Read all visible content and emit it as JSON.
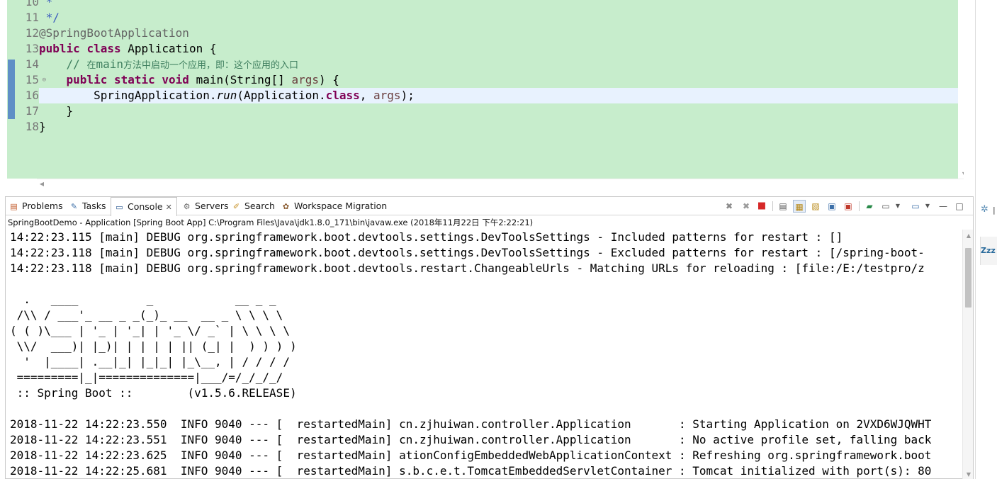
{
  "editor": {
    "line_numbers": [
      "10",
      "11",
      "12",
      "13",
      "14",
      "15",
      "16",
      "17",
      "18"
    ],
    "lines": [
      " *",
      " */",
      "@SpringBootApplication",
      "public class Application {",
      "    // 在main方法中启动一个应用，即：这个应用的入口",
      "    public static void main(String[] args) {",
      "        SpringApplication.run(Application.class, args);",
      "    }",
      "}"
    ],
    "fold_marker": "⊖",
    "background_color": "#c7edcc"
  },
  "panel": {
    "tabs": [
      {
        "label": "Problems",
        "icon": "problems-icon"
      },
      {
        "label": "Tasks",
        "icon": "tasks-icon"
      },
      {
        "label": "Console",
        "icon": "console-icon",
        "active": true,
        "close": "✕"
      },
      {
        "label": "Servers",
        "icon": "servers-icon"
      },
      {
        "label": "Search",
        "icon": "search-icon"
      },
      {
        "label": "Workspace Migration",
        "icon": "workspace-migration-icon"
      }
    ],
    "console_description": "SpringBootDemo - Application [Spring Boot App] C:\\Program Files\\Java\\jdk1.8.0_171\\bin\\javaw.exe (2018年11月22日 下午2:22:21)",
    "console_lines": [
      "14:22:23.115 [main] DEBUG org.springframework.boot.devtools.settings.DevToolsSettings - Included patterns for restart : []",
      "14:22:23.118 [main] DEBUG org.springframework.boot.devtools.settings.DevToolsSettings - Excluded patterns for restart : [/spring-boot-",
      "14:22:23.118 [main] DEBUG org.springframework.boot.devtools.restart.ChangeableUrls - Matching URLs for reloading : [file:/E:/testpro/z",
      "",
      "  .   ____          _            __ _ _",
      " /\\\\ / ___'_ __ _ _(_)_ __  __ _ \\ \\ \\ \\",
      "( ( )\\___ | '_ | '_| | '_ \\/ _` | \\ \\ \\ \\",
      " \\\\/  ___)| |_)| | | | | || (_| |  ) ) ) )",
      "  '  |____| .__|_| |_|_| |_\\__, | / / / /",
      " =========|_|==============|___/=/_/_/_/",
      " :: Spring Boot ::        (v1.5.6.RELEASE)",
      "",
      "2018-11-22 14:22:23.550  INFO 9040 --- [  restartedMain] cn.zjhuiwan.controller.Application       : Starting Application on 2VXD6WJQWHT",
      "2018-11-22 14:22:23.551  INFO 9040 --- [  restartedMain] cn.zjhuiwan.controller.Application       : No active profile set, falling back",
      "2018-11-22 14:22:23.625  INFO 9040 --- [  restartedMain] ationConfigEmbeddedWebApplicationContext : Refreshing org.springframework.boot",
      "2018-11-22 14:22:25.681  INFO 9040 --- [  restartedMain] s.b.c.e.t.TomcatEmbeddedServletContainer : Tomcat initialized with port(s): 80"
    ]
  },
  "right_strip": {
    "label": "Zzz"
  }
}
